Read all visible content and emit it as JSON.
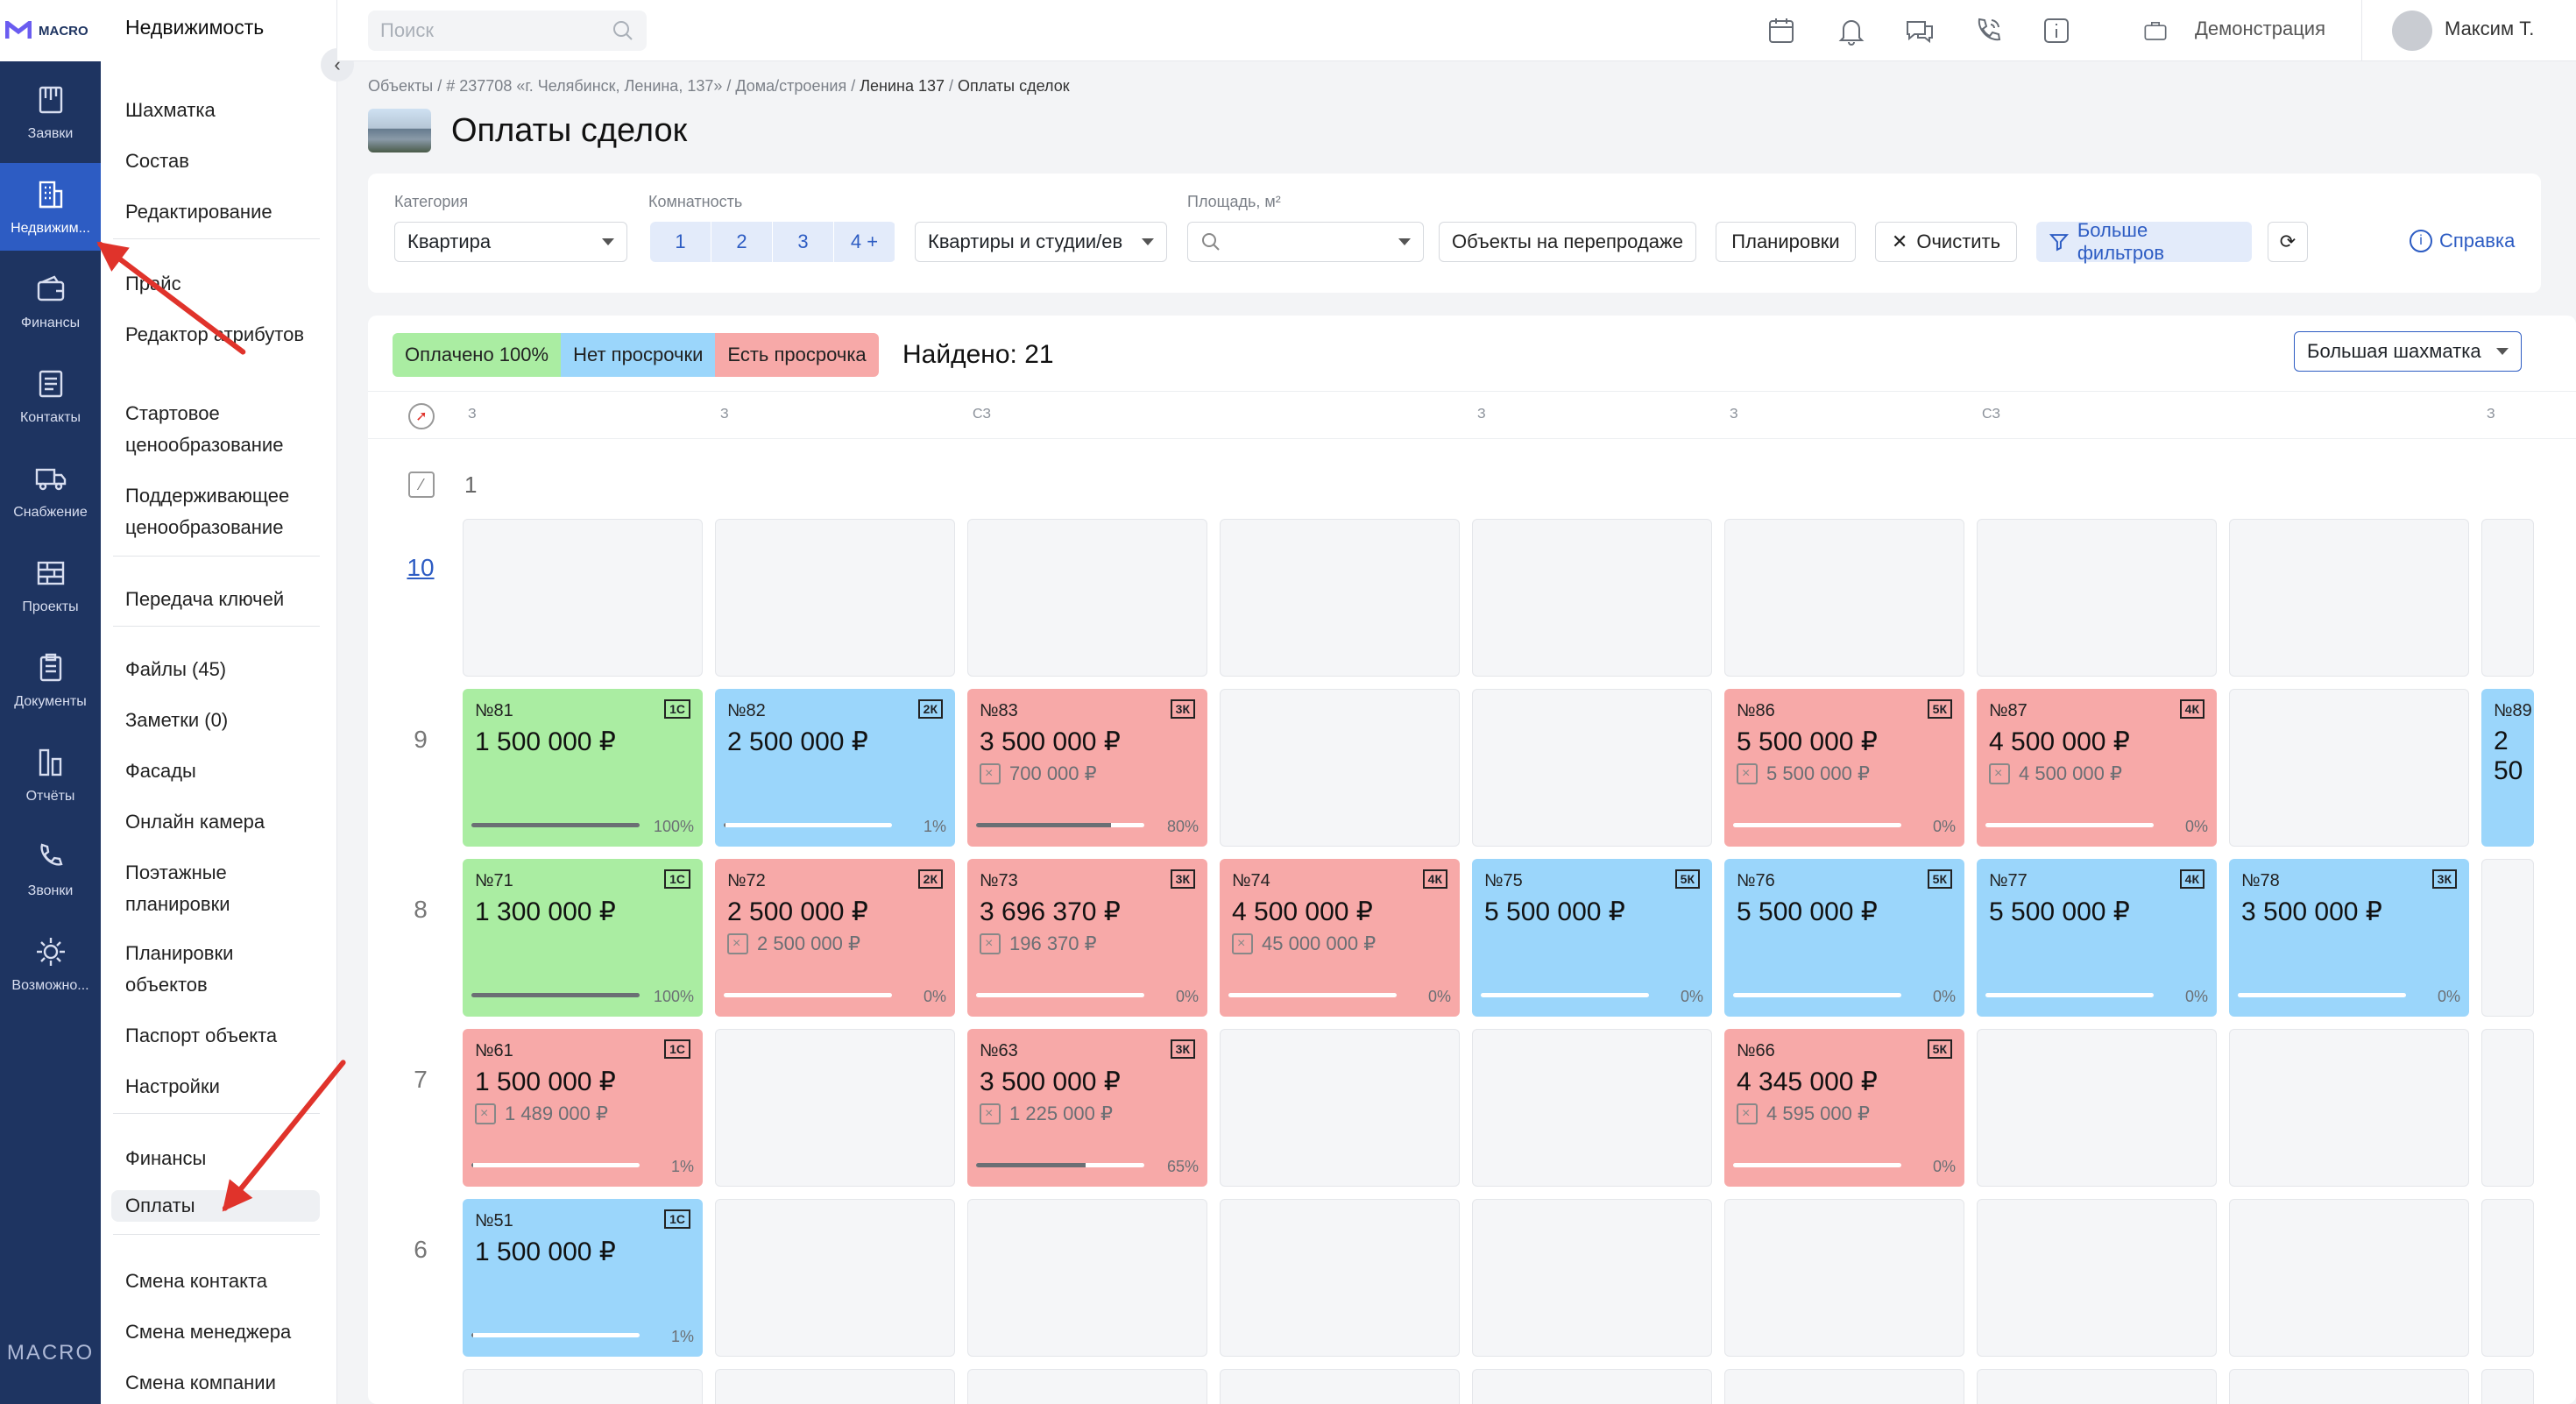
{
  "brand": {
    "name": "MACRO",
    "footer": "MACRO"
  },
  "rail": [
    {
      "label": "Заявки",
      "icon": "applications-icon"
    },
    {
      "label": "Недвижим...",
      "icon": "building-icon"
    },
    {
      "label": "Финансы",
      "icon": "wallet-icon"
    },
    {
      "label": "Контакты",
      "icon": "contacts-icon"
    },
    {
      "label": "Снабжение",
      "icon": "truck-icon"
    },
    {
      "label": "Проекты",
      "icon": "projects-icon"
    },
    {
      "label": "Документы",
      "icon": "documents-icon"
    },
    {
      "label": "Отчёты",
      "icon": "reports-icon"
    },
    {
      "label": "Звонки",
      "icon": "phone-icon"
    },
    {
      "label": "Возможно...",
      "icon": "gear-icon"
    }
  ],
  "menu": {
    "title": "Недвижимость",
    "items": [
      "Шахматка",
      "Состав",
      "Редактирование",
      "Прайс",
      "Редактор атрибутов",
      "Стартовое ценообразование",
      "Поддерживающее ценообразование",
      "Передача ключей",
      "Файлы (45)",
      "Заметки (0)",
      "Фасады",
      "Онлайн камера",
      "Поэтажные планировки",
      "Планировки объектов",
      "Паспорт объекта",
      "Настройки",
      "Финансы",
      "Оплаты",
      "Смена контакта",
      "Смена менеджера",
      "Смена компании"
    ]
  },
  "topbar": {
    "search_placeholder": "Поиск",
    "demo": "Демонстрация",
    "user": "Максим Т."
  },
  "breadcrumbs": [
    "Объекты",
    "# 237708 «г. Челябинск, Ленина, 137»",
    "Дома/строения",
    "Ленина 137",
    "Оплаты сделок"
  ],
  "page_title": "Оплаты сделок",
  "filters": {
    "category_label": "Категория",
    "category_value": "Квартира",
    "rooms_label": "Комнатность",
    "rooms": [
      "1",
      "2",
      "3",
      "4 +"
    ],
    "type_value": "Квартиры и студии/ев",
    "area_label": "Площадь, м²",
    "resale": "Объекты на перепродаже",
    "layouts": "Планировки",
    "clear": "Очистить",
    "more": "Больше фильтров",
    "help": "Справка"
  },
  "legend": [
    {
      "label": "Оплачено 100%",
      "color": "#aaeda2"
    },
    {
      "label": "Нет просрочки",
      "color": "#9bd6fb"
    },
    {
      "label": "Есть просрочка",
      "color": "#f7a9a8"
    }
  ],
  "found": "Найдено: 21",
  "view_select": "Большая шахматка",
  "grid": {
    "column_letters": [
      "З",
      "З",
      "СЗ",
      "",
      "З",
      "З",
      "СЗ",
      "",
      "З"
    ],
    "section_label": "1",
    "floors": [
      {
        "floor": "10",
        "cells": [
          null,
          null,
          null,
          null,
          null,
          null,
          null,
          null,
          null
        ]
      },
      {
        "floor": "9",
        "cells": [
          {
            "num": "№81",
            "tag": "1С",
            "price": "1 500 000 ₽",
            "debt": "",
            "pct": "100%",
            "status": "green",
            "progress": 1.0
          },
          {
            "num": "№82",
            "tag": "2К",
            "price": "2 500 000 ₽",
            "debt": "",
            "pct": "1%",
            "status": "blue",
            "progress": 0.01
          },
          {
            "num": "№83",
            "tag": "3К",
            "price": "3 500 000 ₽",
            "debt": "700 000 ₽",
            "pct": "80%",
            "status": "red",
            "progress": 0.8
          },
          null,
          null,
          {
            "num": "№86",
            "tag": "5К",
            "price": "5 500 000 ₽",
            "debt": "5 500 000 ₽",
            "pct": "0%",
            "status": "red",
            "progress": 0
          },
          {
            "num": "№87",
            "tag": "4К",
            "price": "4 500 000 ₽",
            "debt": "4 500 000 ₽",
            "pct": "0%",
            "status": "red",
            "progress": 0
          },
          null,
          {
            "num": "№89",
            "tag": "",
            "price": "2 50",
            "debt": "",
            "pct": "",
            "status": "blue",
            "progress": 0
          }
        ]
      },
      {
        "floor": "8",
        "cells": [
          {
            "num": "№71",
            "tag": "1С",
            "price": "1 300 000 ₽",
            "debt": "",
            "pct": "100%",
            "status": "green",
            "progress": 1.0
          },
          {
            "num": "№72",
            "tag": "2К",
            "price": "2 500 000 ₽",
            "debt": "2 500 000 ₽",
            "pct": "0%",
            "status": "red",
            "progress": 0
          },
          {
            "num": "№73",
            "tag": "3К",
            "price": "3 696 370 ₽",
            "debt": "196 370 ₽",
            "pct": "0%",
            "status": "red",
            "progress": 0
          },
          {
            "num": "№74",
            "tag": "4К",
            "price": "4 500 000 ₽",
            "debt": "45 000 000 ₽",
            "pct": "0%",
            "status": "red",
            "progress": 0
          },
          {
            "num": "№75",
            "tag": "5К",
            "price": "5 500 000 ₽",
            "debt": "",
            "pct": "0%",
            "status": "blue",
            "progress": 0
          },
          {
            "num": "№76",
            "tag": "5К",
            "price": "5 500 000 ₽",
            "debt": "",
            "pct": "0%",
            "status": "blue",
            "progress": 0
          },
          {
            "num": "№77",
            "tag": "4К",
            "price": "5 500 000 ₽",
            "debt": "",
            "pct": "0%",
            "status": "blue",
            "progress": 0
          },
          {
            "num": "№78",
            "tag": "3К",
            "price": "3 500 000 ₽",
            "debt": "",
            "pct": "0%",
            "status": "blue",
            "progress": 0
          },
          null
        ]
      },
      {
        "floor": "7",
        "cells": [
          {
            "num": "№61",
            "tag": "1С",
            "price": "1 500 000 ₽",
            "debt": "1 489 000 ₽",
            "pct": "1%",
            "status": "red",
            "progress": 0.01
          },
          null,
          {
            "num": "№63",
            "tag": "3К",
            "price": "3 500 000 ₽",
            "debt": "1 225 000 ₽",
            "pct": "65%",
            "status": "red",
            "progress": 0.65
          },
          null,
          null,
          {
            "num": "№66",
            "tag": "5К",
            "price": "4 345 000 ₽",
            "debt": "4 595 000 ₽",
            "pct": "0%",
            "status": "red",
            "progress": 0
          },
          null,
          null,
          null
        ]
      },
      {
        "floor": "6",
        "cells": [
          {
            "num": "№51",
            "tag": "1С",
            "price": "1 500 000 ₽",
            "debt": "",
            "pct": "1%",
            "status": "blue",
            "progress": 0.01
          },
          null,
          null,
          null,
          null,
          null,
          null,
          null,
          null
        ]
      }
    ]
  }
}
